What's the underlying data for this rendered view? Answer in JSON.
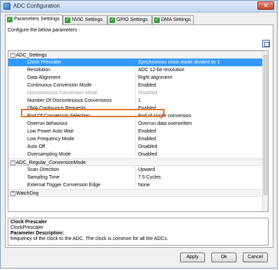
{
  "window": {
    "title": "ADC Configuration",
    "close_glyph": "✕"
  },
  "tabs": [
    {
      "label": "Parameters Setttings",
      "icon": "check-icon"
    },
    {
      "label": "NVIC Settings",
      "icon": "check-icon"
    },
    {
      "label": "GPIO Settings",
      "icon": "check-icon"
    },
    {
      "label": "DMA Settings",
      "icon": "check-icon"
    }
  ],
  "configure_text": "Configure the below parameters :",
  "groups": {
    "adc_settings": "ADC_Settings",
    "regular": "ADC_Regular_ConversionMode",
    "watchdog": "WatchDog"
  },
  "params": [
    {
      "label": "Clock Prescaler",
      "value": "Synchronous clock mode divided by 1"
    },
    {
      "label": "Resolution",
      "value": "ADC 12-bit resolution"
    },
    {
      "label": "Data Alignment",
      "value": "Right alignment"
    },
    {
      "label": "Continuous Conversion Mode",
      "value": "Enabled"
    },
    {
      "label": "Discontinuous Conversion Mode",
      "value": "Disabled"
    },
    {
      "label": "Number Of Discontinuous Conversions",
      "value": "1"
    },
    {
      "label": "DMA Continuous Requests",
      "value": "Enabled"
    },
    {
      "label": "End Of Conversion Selection",
      "value": "End of single conversion"
    },
    {
      "label": "Overrun behaviour",
      "value": "Overrun data overwritten"
    },
    {
      "label": "Low Power Auto Wait",
      "value": "Enabled"
    },
    {
      "label": "Low Frequency Mode",
      "value": "Enabled"
    },
    {
      "label": "Auto Off",
      "value": "Disabled"
    },
    {
      "label": "Oversampling Mode",
      "value": "Disabled"
    }
  ],
  "regular_params": [
    {
      "label": "Scan Direction",
      "value": "Upward"
    },
    {
      "label": "Sampling Time",
      "value": "7.5 Cycles"
    },
    {
      "label": "External Trigger Conversion Edge",
      "value": "None"
    }
  ],
  "description": {
    "title": "Clock Prescaler",
    "name": "ClockPrescaler",
    "heading": "Parameter Description:",
    "text": "frequency of the clock to the ADC. The clock is common for all the ADCs."
  },
  "buttons": {
    "apply": "Apply",
    "ok": "Ok",
    "cancel": "Cancel"
  },
  "colors": {
    "selection": "#3399ff",
    "highlight": "#e2772a"
  }
}
